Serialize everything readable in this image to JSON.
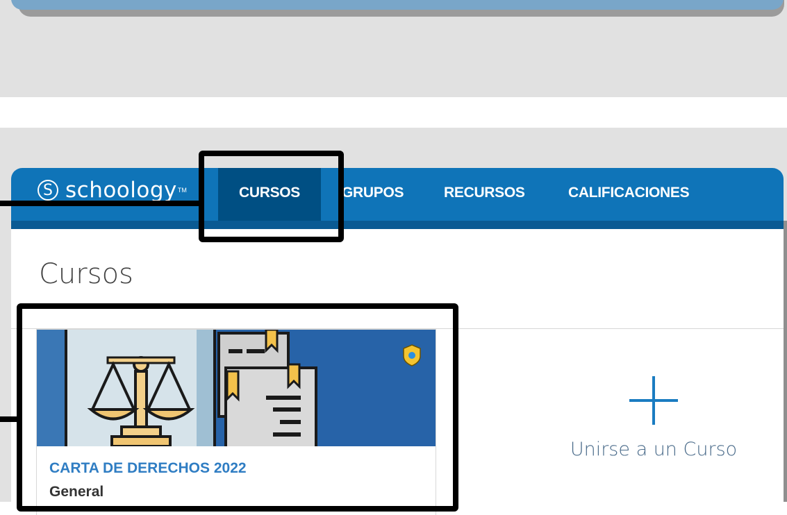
{
  "nav": {
    "logo_text": "schoology",
    "logo_tm": "TM",
    "items": [
      {
        "label": "CURSOS",
        "active": true
      },
      {
        "label": "GRUPOS",
        "active": false
      },
      {
        "label": "RECURSOS",
        "active": false
      },
      {
        "label": "CALIFICACIONES",
        "active": false
      }
    ]
  },
  "main": {
    "title": "Cursos",
    "course": {
      "name": "CARTA DE DERECHOS 2022",
      "section": "General"
    },
    "join_label": "Unirse a un Curso"
  },
  "colors": {
    "nav_bg": "#0f74b8",
    "nav_active": "#004f83",
    "course_link": "#2f7dc3",
    "highlight": "#000000"
  }
}
